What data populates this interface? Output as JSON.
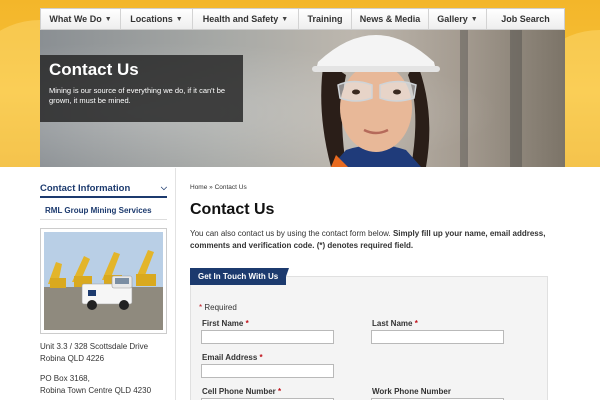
{
  "nav": {
    "items": [
      {
        "label": "What We Do",
        "dropdown": true
      },
      {
        "label": "Locations",
        "dropdown": true
      },
      {
        "label": "Health and Safety",
        "dropdown": true
      },
      {
        "label": "Training",
        "dropdown": false
      },
      {
        "label": "News & Media",
        "dropdown": false
      },
      {
        "label": "Gallery",
        "dropdown": true
      },
      {
        "label": "Job Search",
        "dropdown": false
      }
    ]
  },
  "hero": {
    "title": "Contact Us",
    "subtitle": "Mining is our source of everything we do, if it can't be grown, it must be mined."
  },
  "sidebar": {
    "heading": "Contact Information",
    "link": "RML Group Mining Services",
    "address1_line1": "Unit 3.3 / 328 Scottsdale Drive",
    "address1_line2": "Robina QLD 4226",
    "address2_line1": "PO Box 3168,",
    "address2_line2": "Robina Town Centre QLD 4230"
  },
  "breadcrumb": {
    "home": "Home",
    "separator": " » ",
    "current": "Contact Us"
  },
  "main": {
    "title": "Contact Us",
    "intro_plain": "You can also contact us by using the contact form below. ",
    "intro_bold": "Simply fill up your name, email address, comments and verification code. (*) denotes required field."
  },
  "form": {
    "tab_label": "Get In Touch With Us",
    "required_star": "*",
    "required_note": " Required",
    "fields": {
      "first_name": "First Name",
      "last_name": "Last Name",
      "email": "Email Address",
      "cell_phone": "Cell Phone Number",
      "work_phone": "Work Phone Number"
    }
  },
  "colors": {
    "brand_navy": "#1c3a6e",
    "band_yellow": "#f7c23a",
    "required_red": "#c0121b"
  }
}
